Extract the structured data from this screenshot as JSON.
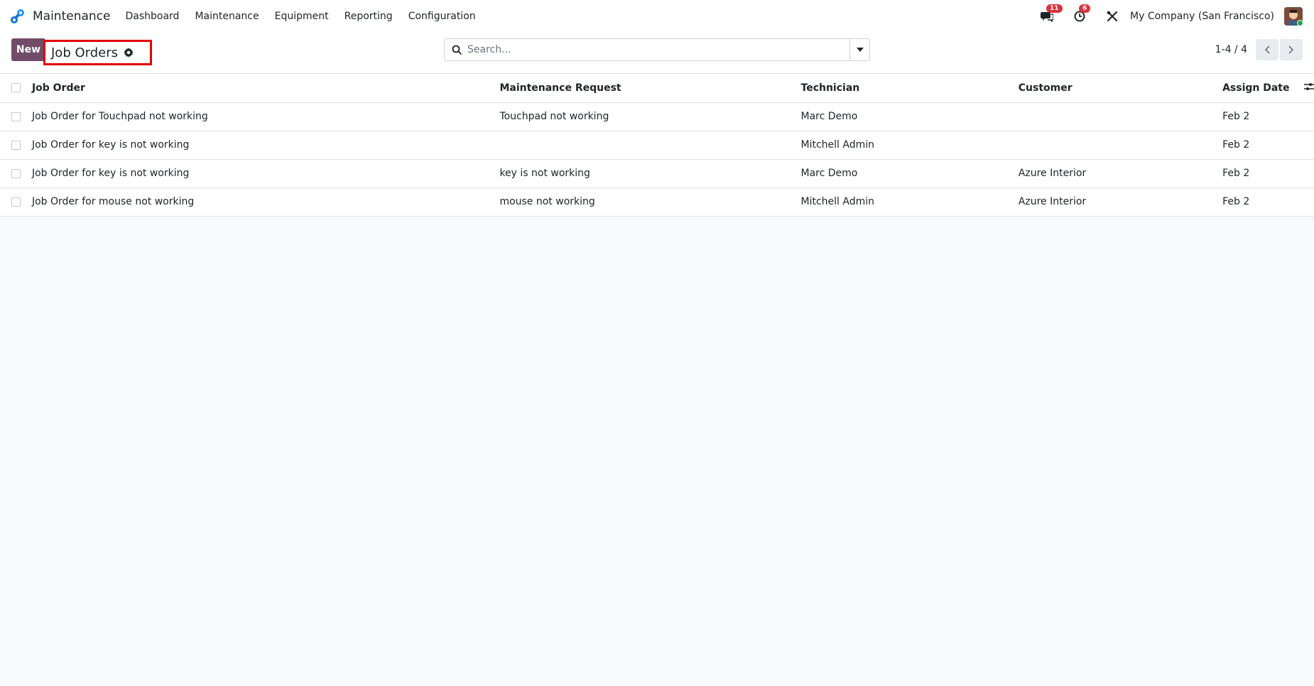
{
  "navbar": {
    "app_name": "Maintenance",
    "menu": [
      {
        "label": "Dashboard"
      },
      {
        "label": "Maintenance"
      },
      {
        "label": "Equipment"
      },
      {
        "label": "Reporting"
      },
      {
        "label": "Configuration"
      }
    ],
    "messages_badge": "11",
    "activities_badge": "6",
    "company": "My Company (San Francisco)"
  },
  "control_panel": {
    "new_label": "New",
    "breadcrumb": "Job Orders",
    "search_placeholder": "Search...",
    "pager": "1-4 / 4"
  },
  "table": {
    "headers": {
      "job_order": "Job Order",
      "maintenance_request": "Maintenance Request",
      "technician": "Technician",
      "customer": "Customer",
      "assign_date": "Assign Date"
    },
    "rows": [
      {
        "job_order": "Job Order for Touchpad not working",
        "maintenance_request": "Touchpad not working",
        "technician": "Marc Demo",
        "customer": "",
        "assign_date": "Feb 2"
      },
      {
        "job_order": "Job Order for key is not working",
        "maintenance_request": "",
        "technician": "Mitchell Admin",
        "customer": "",
        "assign_date": "Feb 2"
      },
      {
        "job_order": "Job Order for key is not working",
        "maintenance_request": "key is not working",
        "technician": "Marc Demo",
        "customer": "Azure Interior",
        "assign_date": "Feb 2"
      },
      {
        "job_order": "Job Order for mouse not working",
        "maintenance_request": "mouse not working",
        "technician": "Mitchell Admin",
        "customer": "Azure Interior",
        "assign_date": "Feb 2"
      }
    ]
  },
  "colors": {
    "primary": "#714b67",
    "highlight_border": "#e20000",
    "badge": "#d9323b",
    "logo": "#2196f3"
  }
}
